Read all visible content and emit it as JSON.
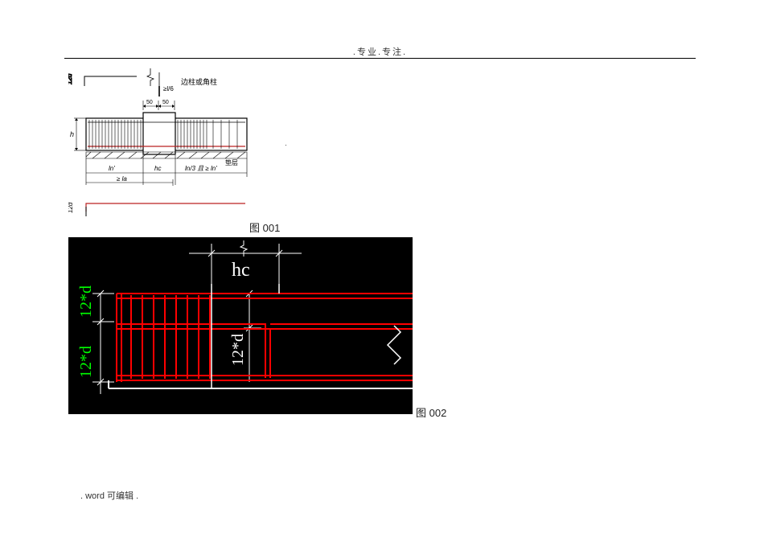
{
  "header": {
    "watermark": ".专业.专注."
  },
  "figure1": {
    "caption": "图 001",
    "labels": {
      "top_dim1": "12d",
      "top_annotation": "边柱或角柱",
      "top_vert": "≥l/6",
      "small50a": "50",
      "small50b": "50",
      "left_h": "h",
      "right_note": "垫层",
      "bot_ln": "ln'",
      "bot_hc": "hc",
      "bot_span": "ln/3 且 ≥ ln'",
      "bot_ge": "≥ la",
      "bot_dim2": "12d"
    }
  },
  "figure2": {
    "caption": "图 002",
    "labels": {
      "top_dim": "hc",
      "left_top": "12*d",
      "left_bot": "12*d",
      "center": "12*d"
    }
  },
  "footer": {
    "text": ".  word 可编辑  ."
  }
}
